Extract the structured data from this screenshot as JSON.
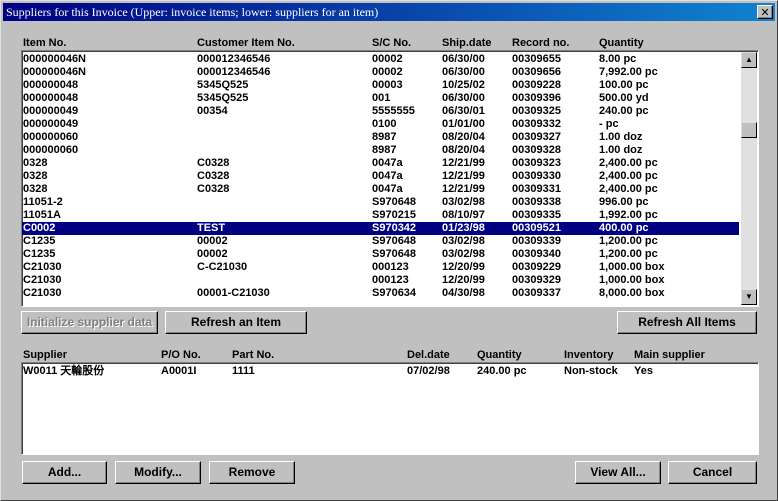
{
  "window": {
    "title": "Suppliers for this Invoice (Upper: invoice items; lower: suppliers for an item)",
    "close": "✕"
  },
  "items_table": {
    "headers": [
      "Item No.",
      "Customer Item No.",
      "S/C No.",
      "Ship.date",
      "Record no.",
      "Quantity"
    ],
    "selected_index": 13,
    "rows": [
      [
        "000000046N",
        "000012346546",
        "00002",
        "06/30/00",
        "00309655",
        "8.00 pc"
      ],
      [
        "000000046N",
        "000012346546",
        "00002",
        "06/30/00",
        "00309656",
        "7,992.00 pc"
      ],
      [
        "000000048",
        "5345Q525",
        "00003",
        "10/25/02",
        "00309228",
        "100.00 pc"
      ],
      [
        "000000048",
        "5345Q525",
        "001",
        "06/30/00",
        "00309396",
        "500.00 yd"
      ],
      [
        "000000049",
        "00354",
        "5555555",
        "06/30/01",
        "00309325",
        "240.00 pc"
      ],
      [
        "000000049",
        "",
        "0100",
        "01/01/00",
        "00309332",
        "- pc"
      ],
      [
        "000000060",
        "",
        "8987",
        "08/20/04",
        "00309327",
        "1.00 doz"
      ],
      [
        "000000060",
        "",
        "8987",
        "08/20/04",
        "00309328",
        "1.00 doz"
      ],
      [
        "0328",
        "C0328",
        "0047a",
        "12/21/99",
        "00309323",
        "2,400.00 pc"
      ],
      [
        "0328",
        "C0328",
        "0047a",
        "12/21/99",
        "00309330",
        "2,400.00 pc"
      ],
      [
        "0328",
        "C0328",
        "0047a",
        "12/21/99",
        "00309331",
        "2,400.00 pc"
      ],
      [
        "11051-2",
        "",
        "S970648",
        "03/02/98",
        "00309338",
        "996.00 pc"
      ],
      [
        "11051A",
        "",
        "S970215",
        "08/10/97",
        "00309335",
        "1,992.00 pc"
      ],
      [
        "C0002",
        "TEST",
        "S970342",
        "01/23/98",
        "00309521",
        "400.00 pc"
      ],
      [
        "C1235",
        "00002",
        "S970648",
        "03/02/98",
        "00309339",
        "1,200.00 pc"
      ],
      [
        "C1235",
        "00002",
        "S970648",
        "03/02/98",
        "00309340",
        "1,200.00 pc"
      ],
      [
        "C21030",
        "C-C21030",
        "000123",
        "12/20/99",
        "00309229",
        "1,000.00 box"
      ],
      [
        "C21030",
        "",
        "000123",
        "12/20/99",
        "00309329",
        "1,000.00 box"
      ],
      [
        "C21030",
        "00001-C21030",
        "S970634",
        "04/30/98",
        "00309337",
        "8,000.00 box"
      ]
    ]
  },
  "scrollbar": {
    "up_icon": "▲",
    "down_icon": "▼"
  },
  "buttons": {
    "initialize": "Initialize supplier data",
    "refresh_item": "Refresh an Item",
    "refresh_all": "Refresh All Items",
    "add": "Add...",
    "modify": "Modify...",
    "remove": "Remove",
    "view_all": "View All...",
    "cancel": "Cancel"
  },
  "suppliers_table": {
    "headers": [
      "Supplier",
      "P/O No.",
      "Part No.",
      "Del.date",
      "Quantity",
      "Inventory",
      "Main supplier"
    ],
    "rows": [
      [
        "W0011 天輪股份",
        "A0001I",
        "1111",
        "07/02/98",
        "240.00 pc",
        "Non-stock",
        "Yes"
      ]
    ]
  },
  "colors": {
    "selection": "#000080",
    "titlebar_start": "#000080",
    "titlebar_end": "#1084d0",
    "face": "#c0c0c0"
  }
}
